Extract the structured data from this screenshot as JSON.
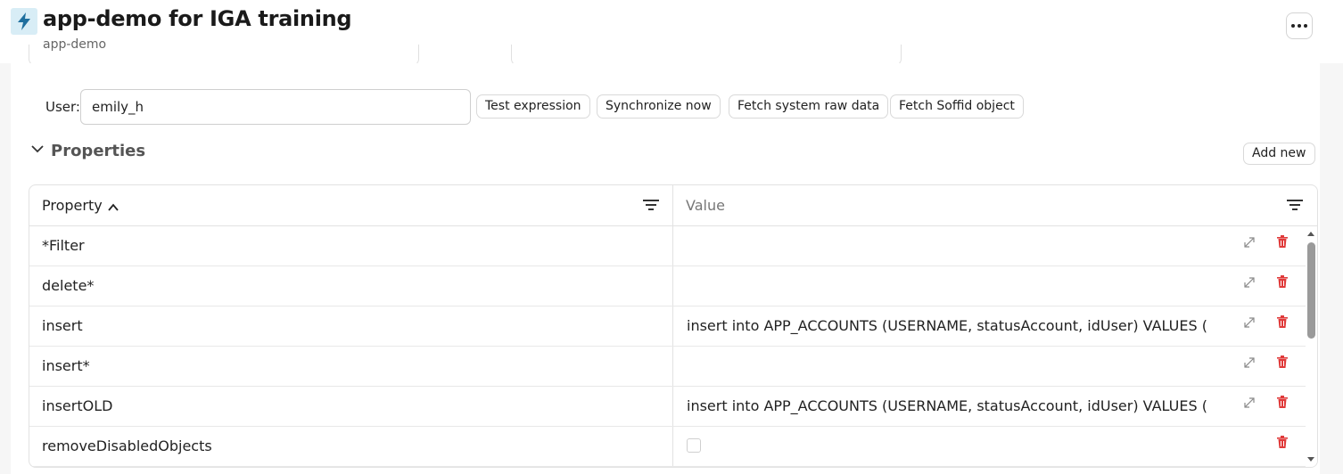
{
  "header": {
    "title": "app-demo for IGA training",
    "subtitle": "app-demo",
    "app_icon": "lightning-bolt-icon",
    "more_icon": "more-horizontal-icon"
  },
  "test_bar": {
    "user_label": "User:",
    "user_value": "emily_h",
    "buttons": [
      {
        "label": "Test expression"
      },
      {
        "label": "Synchronize now"
      },
      {
        "label": "Fetch system raw data"
      },
      {
        "label": "Fetch Soffid object"
      }
    ]
  },
  "properties": {
    "section_title": "Properties",
    "add_new_label": "Add new",
    "columns": {
      "property": "Property",
      "value": "Value"
    },
    "sort": "ascending",
    "rows": [
      {
        "property": "*Filter",
        "value": "",
        "type": "text",
        "expandable": true
      },
      {
        "property": "delete*",
        "value": "",
        "type": "text",
        "expandable": true
      },
      {
        "property": "insert",
        "value": "insert into APP_ACCOUNTS (USERNAME, statusAccount, idUser) VALUES (",
        "type": "text",
        "expandable": true
      },
      {
        "property": "insert*",
        "value": "",
        "type": "text",
        "expandable": true
      },
      {
        "property": "insertOLD",
        "value": "insert into APP_ACCOUNTS (USERNAME, statusAccount, idUser) VALUES (",
        "type": "text",
        "expandable": true
      },
      {
        "property": "removeDisabledObjects",
        "value": "",
        "type": "checkbox",
        "checked": false,
        "expandable": false
      }
    ]
  },
  "colors": {
    "accent": "#1f6f9e",
    "icon_bg": "#d8edf6",
    "delete": "#e03a3a",
    "muted": "#777777"
  }
}
